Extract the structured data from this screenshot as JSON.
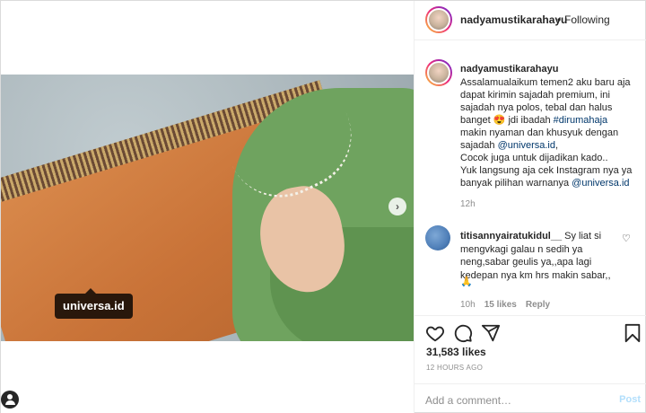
{
  "header": {
    "username": "nadyamustikarahayu",
    "separator": "•",
    "follow_status": "Following"
  },
  "photo": {
    "tag_label": "universa.id",
    "next_icon": "chevron-right-icon"
  },
  "caption": {
    "username": "nadyamustikarahayu",
    "lines": [
      "Assalamualaikum temen2 aku baru aja",
      "dapat kirimin sajadah premium, ini",
      "sajadah nya polos, tebal dan halus",
      "banget",
      "jdi ibadah",
      "#dirumahaja",
      "makin nyaman dan khusyuk dengan",
      "sajadah",
      "@universa.id",
      "Cocok juga untuk dijadikan kado..",
      "Yuk langsung aja cek Instagram nya ya",
      "banyak pilihan warnanya",
      "@universa.id"
    ],
    "emoji": "😍",
    "time": "12h"
  },
  "comment": {
    "username": "titisannyairatukidul__",
    "lines": [
      "Sy liat si",
      "mengvkagi galau n sedih ya",
      "neng,sabar geulis ya,,apa lagi",
      "kedepan nya km hrs makin sabar,,"
    ],
    "emoji": "🙏",
    "time": "10h",
    "likes": "15 likes",
    "reply": "Reply"
  },
  "actions": {
    "like_icon": "heart-icon",
    "comment_icon": "comment-icon",
    "share_icon": "share-icon",
    "save_icon": "bookmark-icon"
  },
  "likes": "31,583 likes",
  "time_ago": "12 HOURS AGO",
  "add_comment": {
    "placeholder": "Add a comment…",
    "post_label": "Post"
  },
  "colors": {
    "link": "#00376b",
    "muted": "#8e8e8e",
    "post_disabled": "#b2dffc"
  }
}
